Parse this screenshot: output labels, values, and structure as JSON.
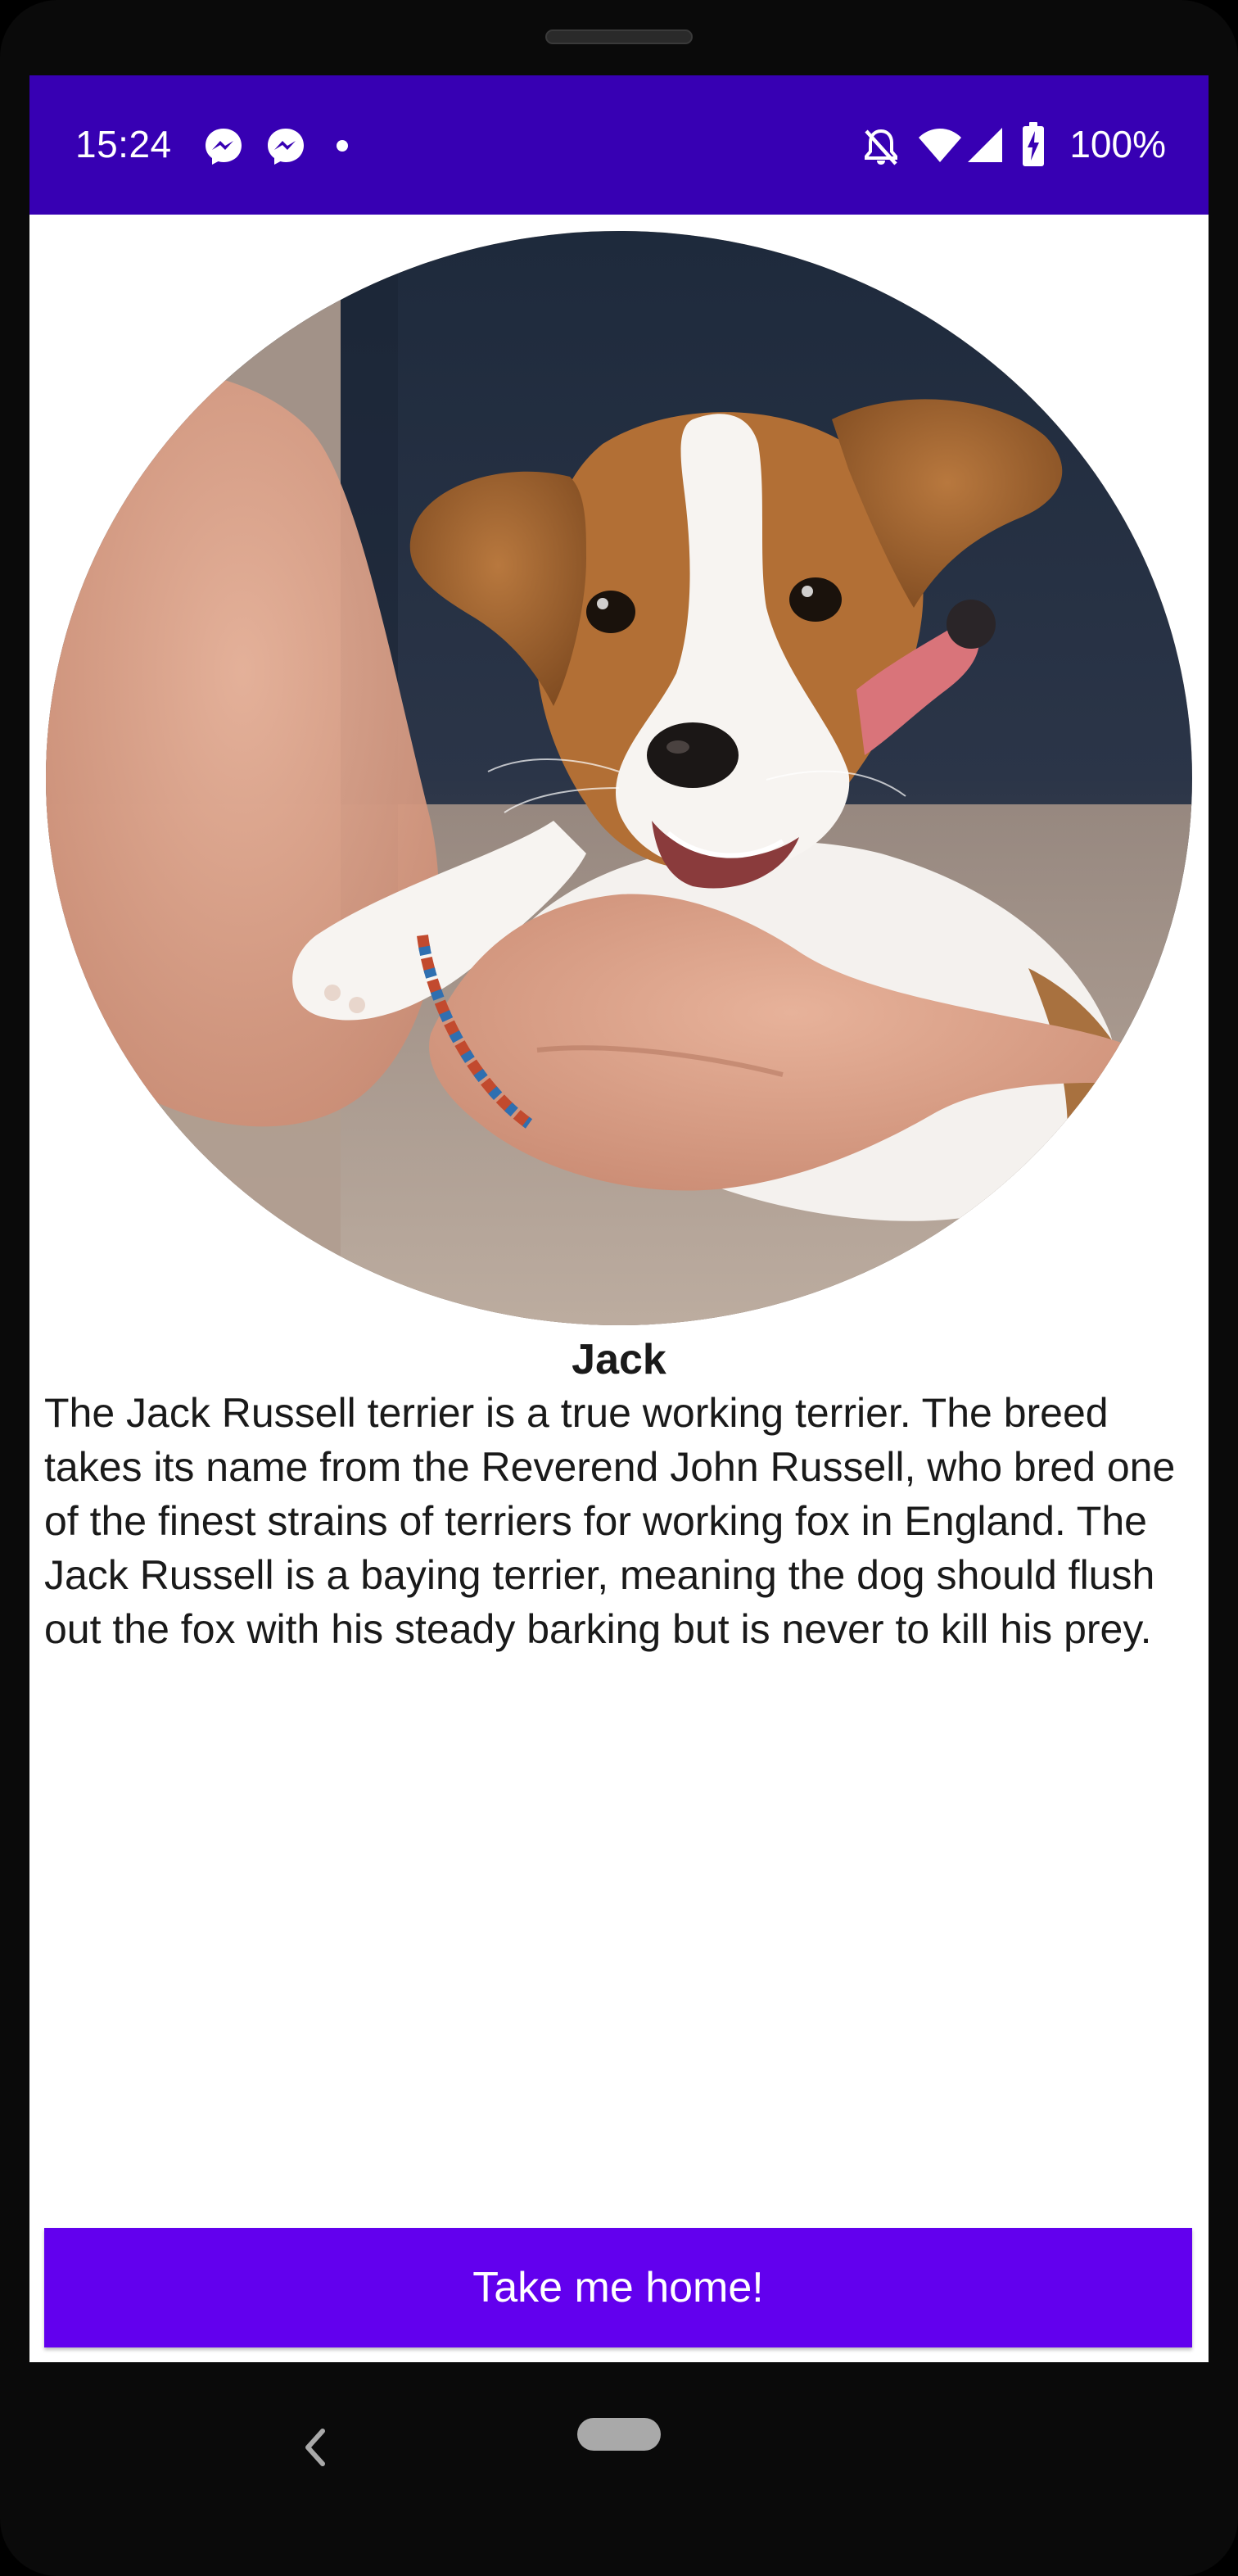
{
  "status_bar": {
    "time": "15:24",
    "left_icons": [
      "messenger-icon",
      "messenger-icon",
      "notification-dot-icon"
    ],
    "right_icons": [
      "do-not-disturb-icon",
      "wifi-icon",
      "cell-signal-icon",
      "battery-charging-icon"
    ],
    "battery_percent": "100%",
    "background_color": "#3700b3"
  },
  "detail": {
    "image_alt": "Jack Russell terrier puppy biting a hand",
    "name": "Jack",
    "description": "The Jack Russell terrier is a true working terrier. The breed takes its name from the Reverend John Russell, who bred one of the finest strains of terriers for working fox in England. The Jack Russell is a baying terrier, meaning the dog should flush out the fox with his steady barking but is never to kill his prey."
  },
  "action": {
    "button_label": "Take me home!",
    "button_color": "#6200ee"
  },
  "navigation": {
    "icons": [
      "back-icon",
      "home-pill-icon"
    ]
  }
}
